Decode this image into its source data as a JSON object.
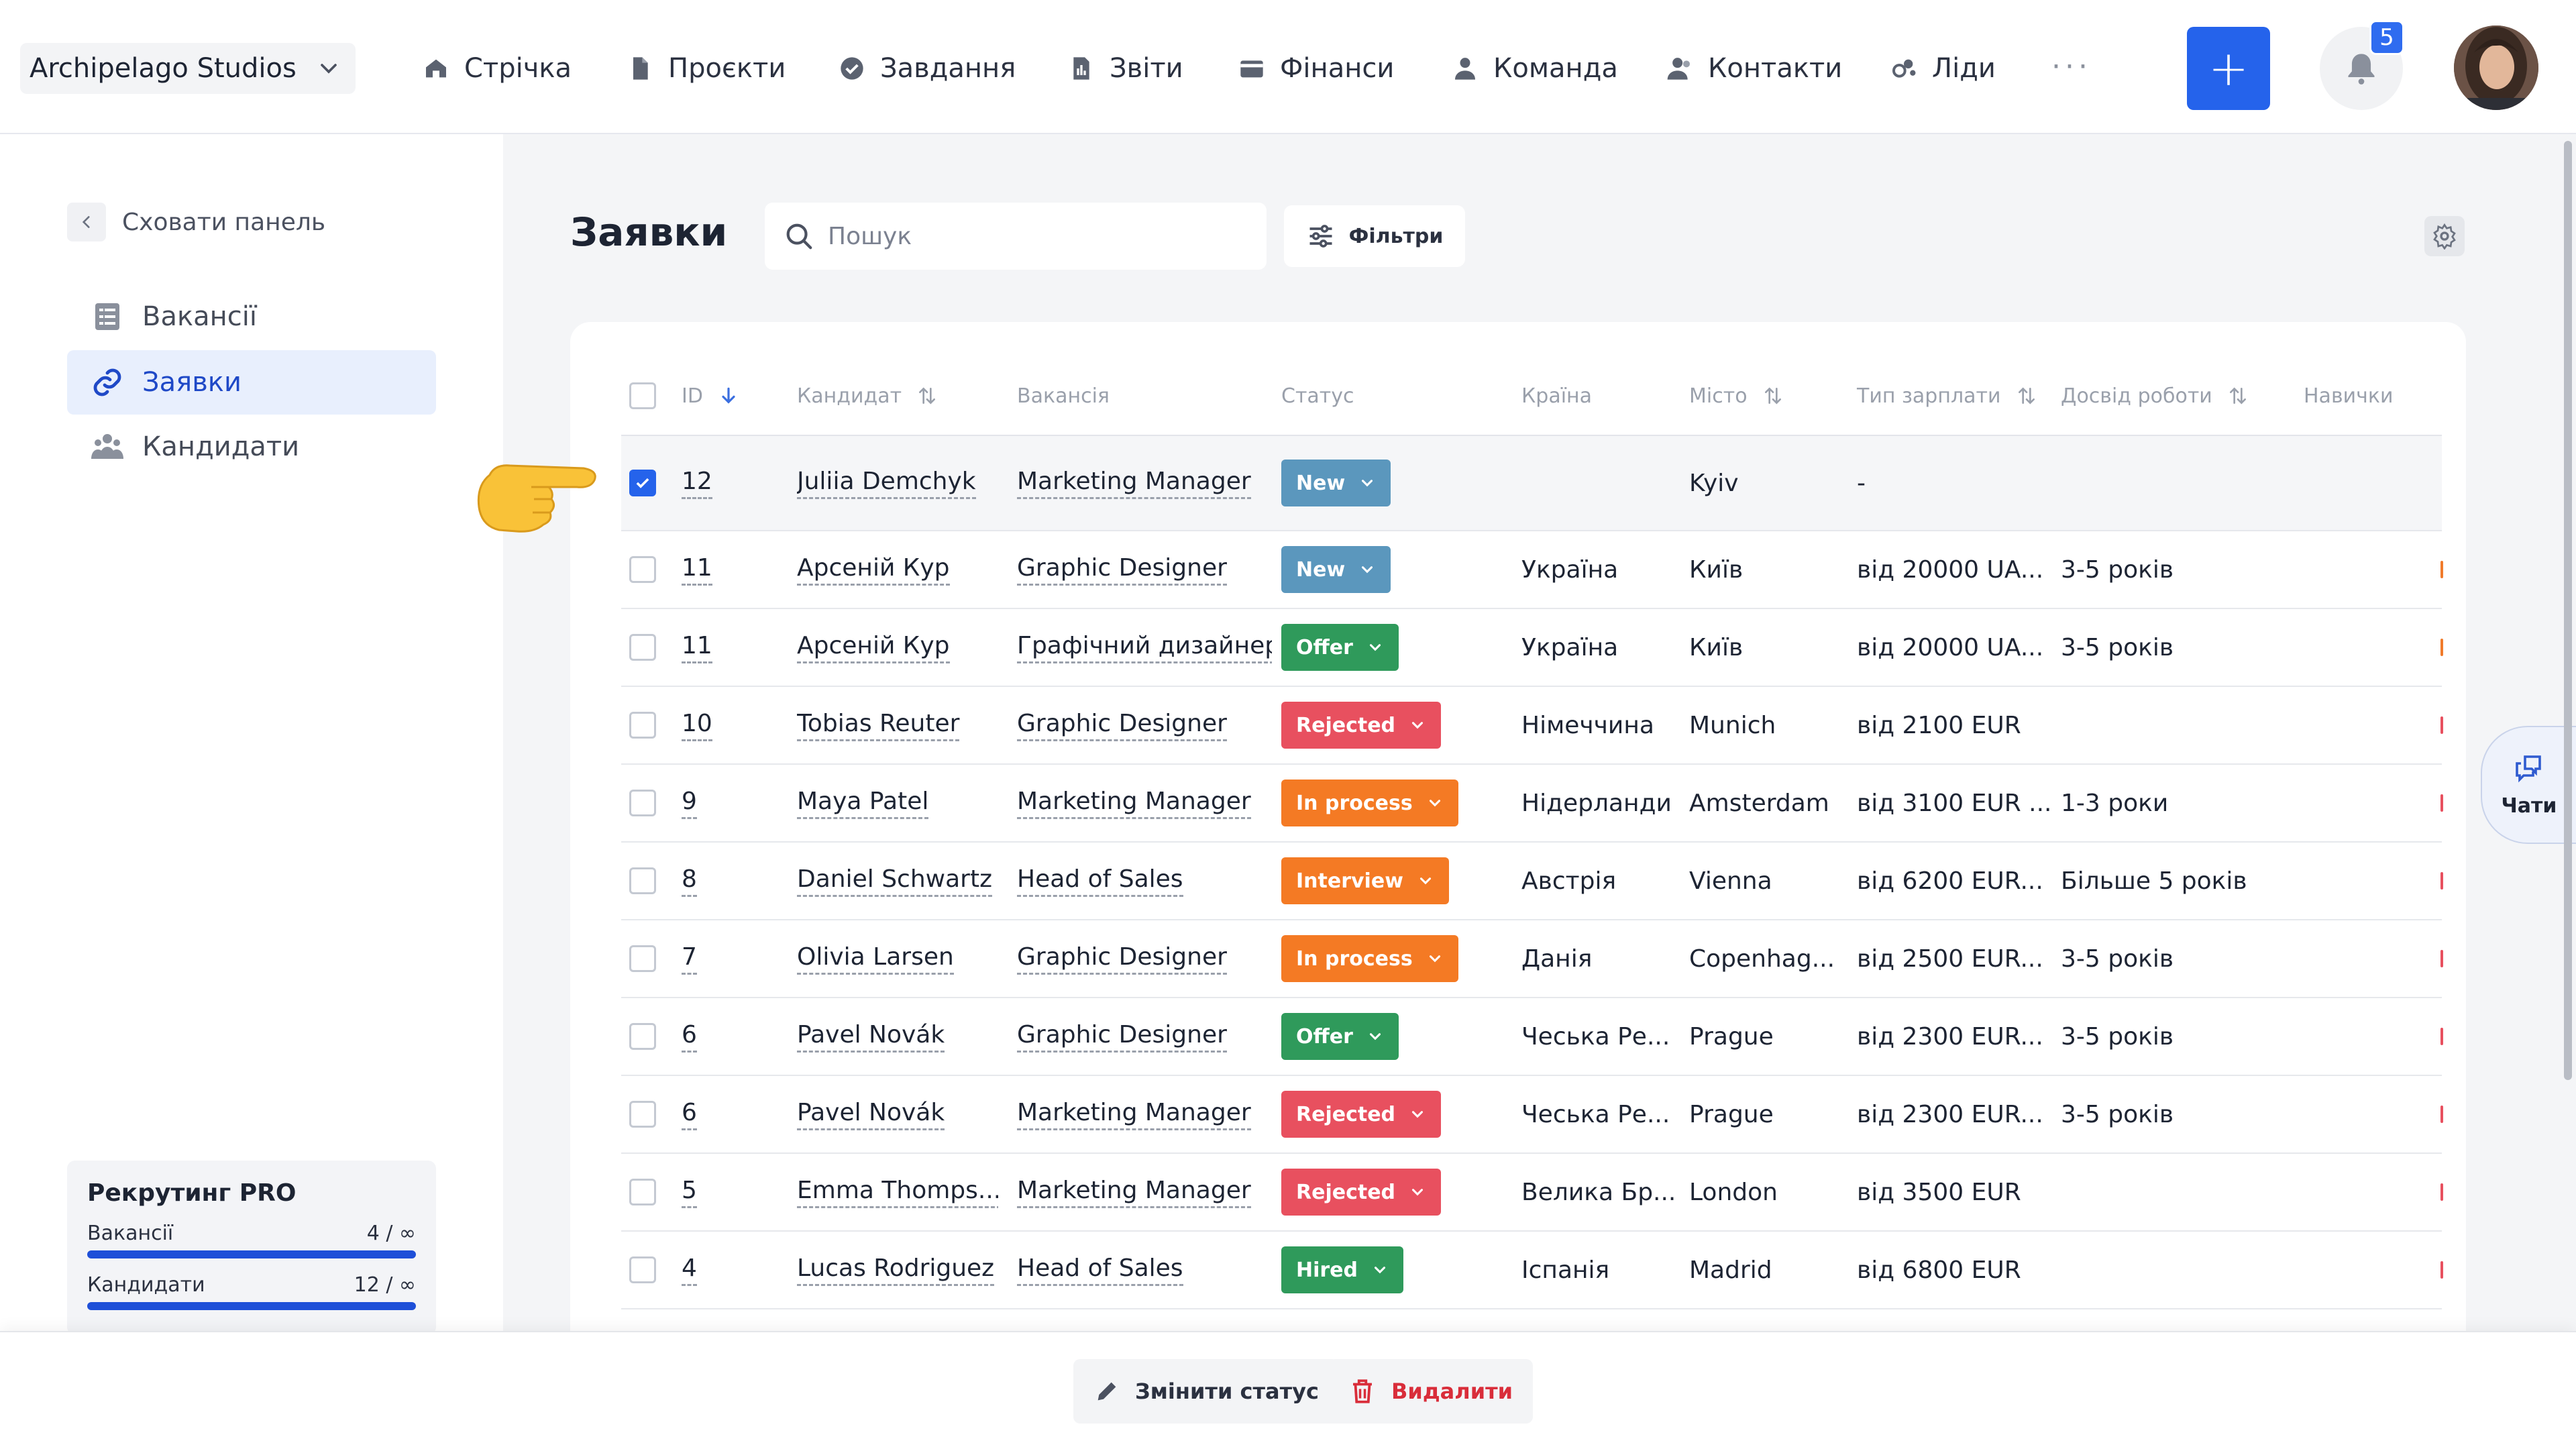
{
  "company": {
    "name": "Archipelago Studios"
  },
  "nav": [
    {
      "label": "Стрічка",
      "icon": "home-icon"
    },
    {
      "label": "Проєкти",
      "icon": "document-icon"
    },
    {
      "label": "Завдання",
      "icon": "check-circle-icon"
    },
    {
      "label": "Звіти",
      "icon": "chart-icon"
    },
    {
      "label": "Фінанси",
      "icon": "wallet-icon"
    },
    {
      "label": "Команда",
      "icon": "user-icon"
    },
    {
      "label": "Контакти",
      "icon": "contacts-icon"
    },
    {
      "label": "Ліди",
      "icon": "leads-icon"
    }
  ],
  "header": {
    "more": "···",
    "add": "+",
    "notifications_count": "5"
  },
  "sidebar": {
    "hide_label": "Сховати панель",
    "items": [
      {
        "label": "Вакансії",
        "icon": "list-icon",
        "active": false
      },
      {
        "label": "Заявки",
        "icon": "link-icon",
        "active": true
      },
      {
        "label": "Кандидати",
        "icon": "people-icon",
        "active": false
      }
    ],
    "plan": {
      "title": "Рекрутинг PRO",
      "rows": [
        {
          "label": "Вакансії",
          "value": "4 / ∞"
        },
        {
          "label": "Кандидати",
          "value": "12 / ∞"
        }
      ]
    }
  },
  "page": {
    "title": "Заявки",
    "search_placeholder": "Пошук",
    "filters_label": "Фільтри"
  },
  "table": {
    "columns": {
      "id": "ID",
      "candidate": "Кандидат",
      "vacancy": "Вакансія",
      "status": "Статус",
      "country": "Країна",
      "city": "Місто",
      "salary": "Тип зарплати",
      "experience": "Досвід роботи",
      "skills": "Навички"
    },
    "rows": [
      {
        "id": "12",
        "candidate": "Juliia Demchyk",
        "vacancy": "Marketing Manager",
        "status": "New",
        "country": "",
        "city": "Kyiv",
        "salary": "-",
        "experience": "",
        "selected": true
      },
      {
        "id": "11",
        "candidate": "Арсеній Кур",
        "vacancy": "Graphic Designer",
        "status": "New",
        "country": "Україна",
        "city": "Київ",
        "salary": "від 20000 UA...",
        "experience": "3-5 років",
        "selected": false
      },
      {
        "id": "11",
        "candidate": "Арсеній Кур",
        "vacancy": "Графічний дизайнер",
        "status": "Offer",
        "country": "Україна",
        "city": "Київ",
        "salary": "від 20000 UA...",
        "experience": "3-5 років",
        "selected": false
      },
      {
        "id": "10",
        "candidate": "Tobias Reuter",
        "vacancy": "Graphic Designer",
        "status": "Rejected",
        "country": "Німеччина",
        "city": "Munich",
        "salary": "від 2100 EUR",
        "experience": "",
        "selected": false
      },
      {
        "id": "9",
        "candidate": "Maya Patel",
        "vacancy": "Marketing Manager",
        "status": "In process",
        "country": "Нідерланди",
        "city": "Amsterdam",
        "salary": "від 3100 EUR ...",
        "experience": "1-3 роки",
        "selected": false
      },
      {
        "id": "8",
        "candidate": "Daniel Schwartz",
        "vacancy": "Head of Sales",
        "status": "Interview",
        "country": "Австрія",
        "city": "Vienna",
        "salary": "від 6200 EUR...",
        "experience": "Більше 5 років",
        "selected": false
      },
      {
        "id": "7",
        "candidate": "Olivia Larsen",
        "vacancy": "Graphic Designer",
        "status": "In process",
        "country": "Данія",
        "city": "Copenhag...",
        "salary": "від 2500 EUR...",
        "experience": "3-5 років",
        "selected": false
      },
      {
        "id": "6",
        "candidate": "Pavel Novák",
        "vacancy": "Graphic Designer",
        "status": "Offer",
        "country": "Чеська Ре...",
        "city": "Prague",
        "salary": "від 2300 EUR...",
        "experience": "3-5 років",
        "selected": false
      },
      {
        "id": "6",
        "candidate": "Pavel Novák",
        "vacancy": "Marketing Manager",
        "status": "Rejected",
        "country": "Чеська Ре...",
        "city": "Prague",
        "salary": "від 2300 EUR...",
        "experience": "3-5 років",
        "selected": false
      },
      {
        "id": "5",
        "candidate": "Emma Thomps...",
        "vacancy": "Marketing Manager",
        "status": "Rejected",
        "country": "Велика Бр...",
        "city": "London",
        "salary": "від 3500 EUR",
        "experience": "",
        "selected": false
      },
      {
        "id": "4",
        "candidate": "Lucas Rodriguez",
        "vacancy": "Head of Sales",
        "status": "Hired",
        "country": "Іспанія",
        "city": "Madrid",
        "salary": "від 6800 EUR",
        "experience": "",
        "selected": false
      }
    ]
  },
  "status_colors": {
    "New": "#5b97bd",
    "Offer": "#2f9a5b",
    "Rejected": "#e8505f",
    "In process": "#f47a24",
    "Interview": "#f47a24",
    "Hired": "#2f9a5b"
  },
  "chats": {
    "label": "Чати"
  },
  "actions": {
    "change_status": "Змінити статус",
    "delete": "Видалити"
  },
  "colors": {
    "accent": "#2563eb",
    "danger": "#d92d3a"
  }
}
